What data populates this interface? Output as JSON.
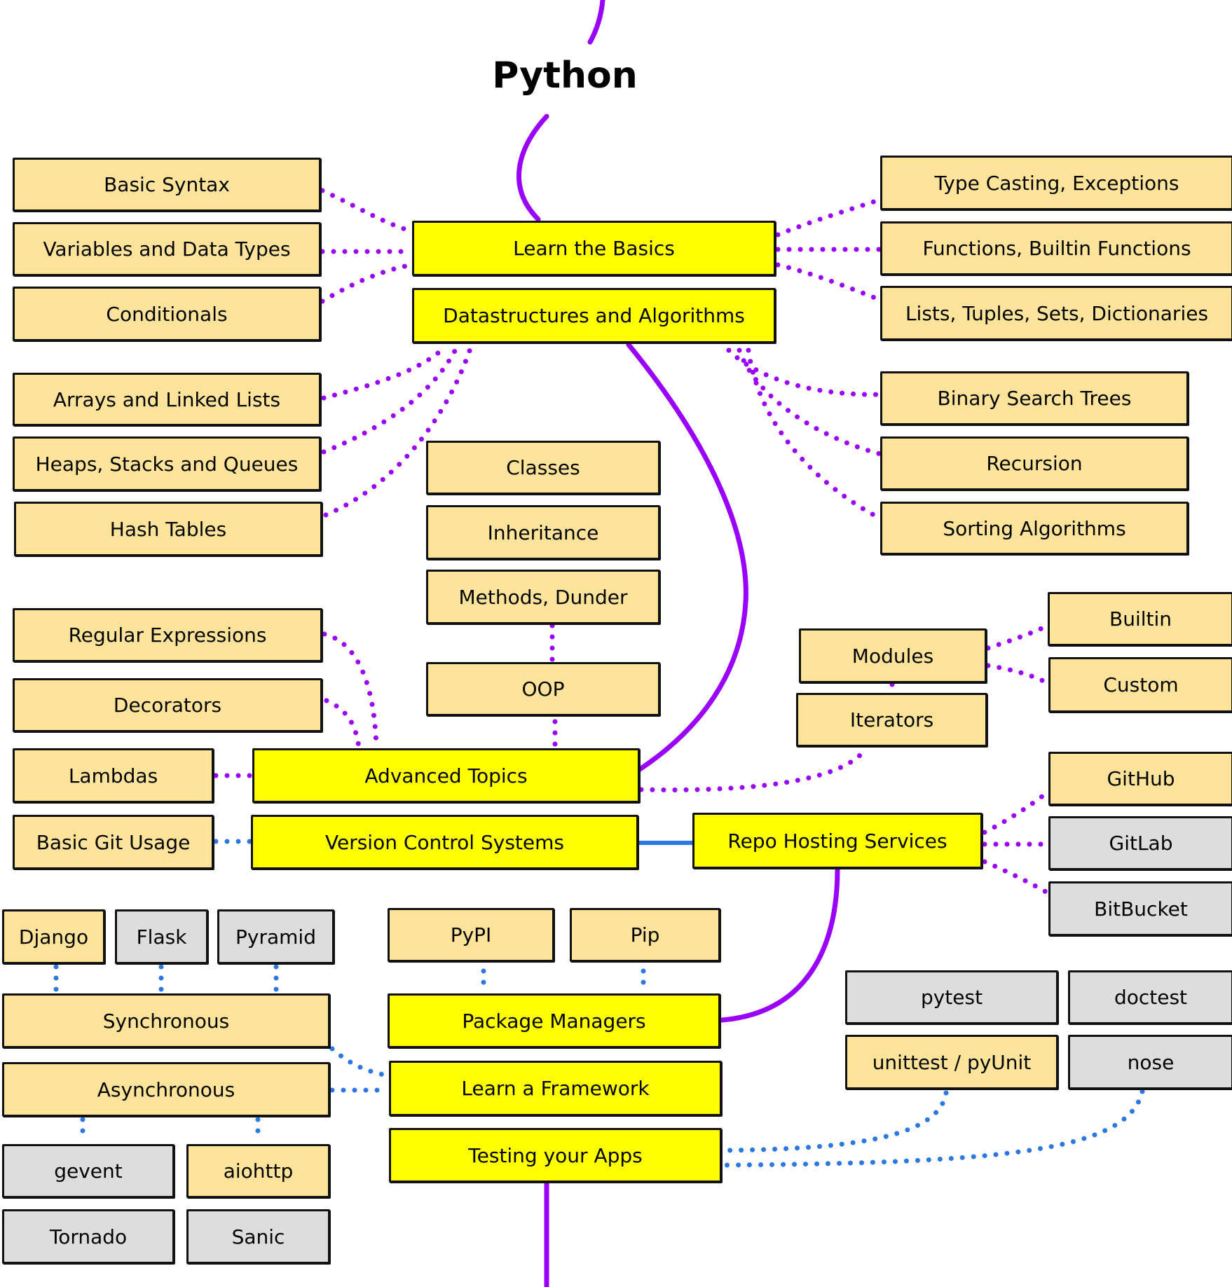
{
  "title": "Python",
  "colors": {
    "topic": "#ffff00",
    "subtopic": "#fee49a",
    "alternative": "#dddddd",
    "main_path": "#9900ff",
    "purple_dots": "#9900ff",
    "blue_dots": "#2b78e4"
  },
  "nodes": {
    "learn_basics": "Learn the Basics",
    "dsa": "Datastructures and Algorithms",
    "basic_syntax": "Basic Syntax",
    "variables": "Variables and Data Types",
    "conditionals": "Conditionals",
    "type_casting": "Type Casting, Exceptions",
    "functions": "Functions, Builtin Functions",
    "lists": "Lists, Tuples, Sets, Dictionaries",
    "arrays": "Arrays and Linked Lists",
    "heaps": "Heaps, Stacks and Queues",
    "hash_tables": "Hash Tables",
    "bst": "Binary Search Trees",
    "recursion": "Recursion",
    "sorting": "Sorting Algorithms",
    "classes": "Classes",
    "inheritance": "Inheritance",
    "methods": "Methods, Dunder",
    "oop": "OOP",
    "regex": "Regular Expressions",
    "decorators": "Decorators",
    "lambdas": "Lambdas",
    "advanced": "Advanced Topics",
    "modules": "Modules",
    "iterators": "Iterators",
    "builtin": "Builtin",
    "custom": "Custom",
    "basic_git": "Basic Git Usage",
    "vcs": "Version Control Systems",
    "repo_hosting": "Repo Hosting Services",
    "github": "GitHub",
    "gitlab": "GitLab",
    "bitbucket": "BitBucket",
    "django": "Django",
    "flask": "Flask",
    "pyramid": "Pyramid",
    "synchronous": "Synchronous",
    "asynchronous": "Asynchronous",
    "gevent": "gevent",
    "aiohttp": "aiohttp",
    "tornado": "Tornado",
    "sanic": "Sanic",
    "pypi": "PyPI",
    "pip": "Pip",
    "package_managers": "Package Managers",
    "learn_framework": "Learn a Framework",
    "testing": "Testing your Apps",
    "pytest": "pytest",
    "doctest": "doctest",
    "unittest": "unittest / pyUnit",
    "nose": "nose"
  }
}
